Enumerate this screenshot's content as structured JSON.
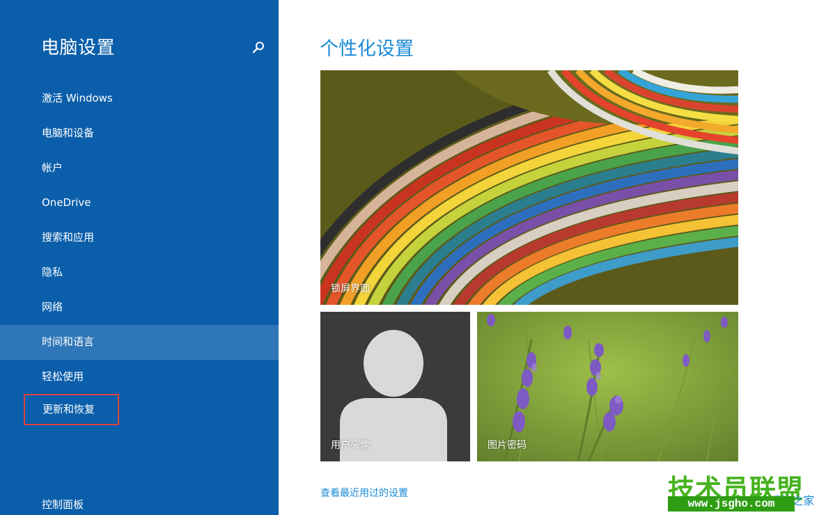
{
  "sidebar": {
    "title": "电脑设置",
    "search_icon": "search-icon",
    "items": [
      {
        "label": "激活 Windows"
      },
      {
        "label": "电脑和设备"
      },
      {
        "label": "帐户"
      },
      {
        "label": "OneDrive"
      },
      {
        "label": "搜索和应用"
      },
      {
        "label": "隐私"
      },
      {
        "label": "网络"
      },
      {
        "label": "时间和语言"
      },
      {
        "label": "轻松使用"
      },
      {
        "label": "更新和恢复"
      }
    ],
    "selected": "时间和语言",
    "highlighted": "更新和恢复",
    "footer": "控制面板"
  },
  "main": {
    "title": "个性化设置",
    "tiles": {
      "lock_screen": "锁屏界面",
      "account_picture": "用户头像",
      "picture_password": "图片密码"
    },
    "recent_link": "查看最近用过的设置"
  },
  "watermark": {
    "brand": "技术员联盟",
    "url": "www.jsgho.com",
    "sub": "Win8系统之家"
  },
  "colors": {
    "sidebar_bg": "#0a5eaa",
    "selected_bg": "#2e76b7",
    "accent": "#1a8ad6",
    "highlight_box": "#e0423f"
  }
}
